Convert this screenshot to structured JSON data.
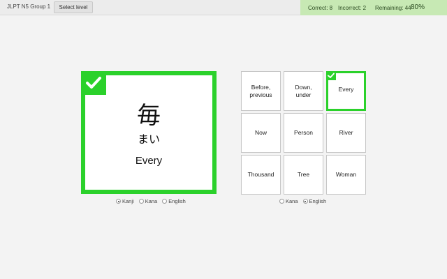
{
  "topbar": {
    "title": "JLPT N5 Group 1",
    "select_level_label": "Select level"
  },
  "stats": {
    "correct": "Correct: 8",
    "incorrect": "Incorrect: 2",
    "remaining": "Remaining: 44",
    "percent": "80%"
  },
  "card": {
    "kanji": "毎",
    "kana": "まい",
    "english": "Every",
    "status_icon": "check-icon"
  },
  "card_display_options": {
    "options": [
      "Kanji",
      "Kana",
      "English"
    ],
    "selected": "Kanji"
  },
  "answers": {
    "tiles": [
      {
        "label_line1": "Before,",
        "label_line2": "previous"
      },
      {
        "label_line1": "Down,",
        "label_line2": "under"
      },
      {
        "label_line1": "Every",
        "label_line2": "",
        "state": "correct"
      },
      {
        "label_line1": "Now",
        "label_line2": ""
      },
      {
        "label_line1": "Person",
        "label_line2": ""
      },
      {
        "label_line1": "River",
        "label_line2": ""
      },
      {
        "label_line1": "Thousand",
        "label_line2": ""
      },
      {
        "label_line1": "Tree",
        "label_line2": ""
      },
      {
        "label_line1": "Woman",
        "label_line2": ""
      }
    ]
  },
  "answer_display_options": {
    "options": [
      "Kana",
      "English"
    ],
    "selected": "English"
  },
  "colors": {
    "correct_green": "#2bd12b",
    "stats_bg": "#c7e9b4",
    "page_bg": "#f3f3f3"
  }
}
